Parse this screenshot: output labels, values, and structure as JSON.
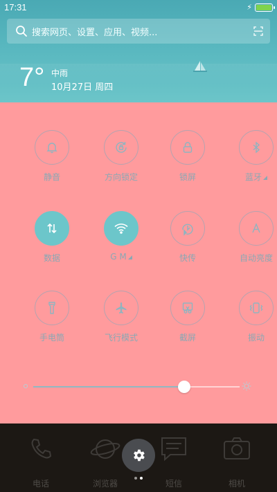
{
  "status": {
    "time": "17:31"
  },
  "search": {
    "placeholder": "搜索网页、设置、应用、视频..."
  },
  "weather": {
    "temp": "7°",
    "condition": "中雨",
    "date": "10月27日 周四"
  },
  "tiles": [
    {
      "label": "静音",
      "icon": "bell-icon",
      "on": false
    },
    {
      "label": "方向锁定",
      "icon": "rotation-lock-icon",
      "on": false
    },
    {
      "label": "锁屏",
      "icon": "lock-icon",
      "on": false
    },
    {
      "label": "蓝牙",
      "icon": "bluetooth-icon",
      "on": false,
      "expand": true
    },
    {
      "label": "数据",
      "icon": "mobile-data-icon",
      "on": true
    },
    {
      "label": "G M",
      "icon": "wifi-icon",
      "on": true,
      "expand": true
    },
    {
      "label": "快传",
      "icon": "quick-transfer-icon",
      "on": false
    },
    {
      "label": "自动亮度",
      "icon": "auto-brightness-icon",
      "on": false
    },
    {
      "label": "手电筒",
      "icon": "flashlight-icon",
      "on": false
    },
    {
      "label": "飞行模式",
      "icon": "airplane-icon",
      "on": false
    },
    {
      "label": "截屏",
      "icon": "screenshot-icon",
      "on": false
    },
    {
      "label": "振动",
      "icon": "vibrate-icon",
      "on": false
    }
  ],
  "brightness": {
    "level": 0.73
  },
  "dock": {
    "apps": [
      {
        "label": "电话",
        "icon": "phone-icon"
      },
      {
        "label": "浏览器",
        "icon": "browser-icon"
      },
      {
        "label": "短信",
        "icon": "message-icon"
      },
      {
        "label": "相机",
        "icon": "camera-icon"
      }
    ],
    "page_count": 2,
    "active_page": 1
  },
  "colors": {
    "panel": "#ff9b9d",
    "accent": "#6cc6ca",
    "weather": "#58b7bf"
  }
}
